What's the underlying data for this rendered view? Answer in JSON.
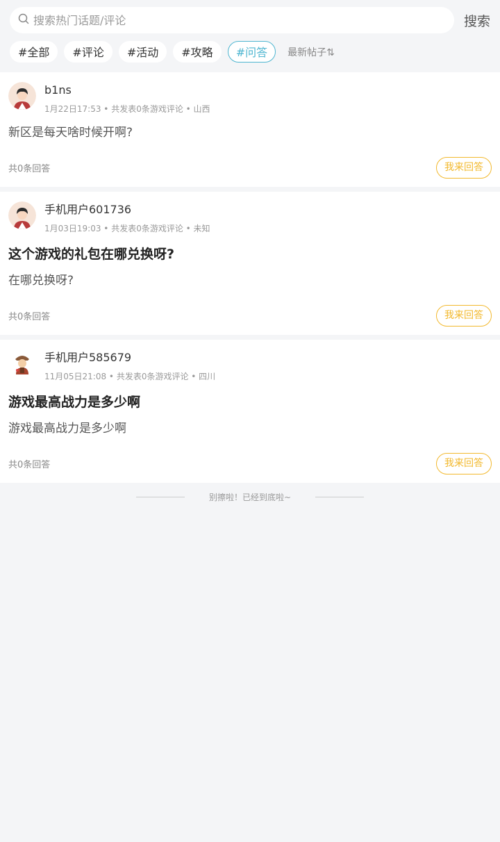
{
  "search": {
    "placeholder": "搜索热门话题/评论",
    "button": "搜索"
  },
  "tags": [
    "#全部",
    "#评论",
    "#活动",
    "#攻略",
    "#问答"
  ],
  "active_tag": 4,
  "sort_label": "最新帖子⇅",
  "posts": [
    {
      "user": "b1ns",
      "meta": "1月22日17:53 • 共发表0条游戏评论 • 山西",
      "title": "",
      "body": "新区是每天啥时候开啊?",
      "answer_count": "共0条回答",
      "answer_btn": "我来回答"
    },
    {
      "user": "手机用户601736",
      "meta": "1月03日19:03 • 共发表0条游戏评论 • 未知",
      "title": "这个游戏的礼包在哪兑换呀?",
      "body": "在哪兑换呀?",
      "answer_count": "共0条回答",
      "answer_btn": "我来回答"
    },
    {
      "user": "手机用户585679",
      "meta": "11月05日21:08 • 共发表0条游戏评论 • 四川",
      "title": "游戏最高战力是多少啊",
      "body": "游戏最高战力是多少啊",
      "answer_count": "共0条回答",
      "answer_btn": "我来回答"
    }
  ],
  "end_text": "别擦啦！已经到底啦~",
  "colors": {
    "accent_tag": "#4db5d0",
    "answer_button": "#f2b82c",
    "background": "#f4f5f7"
  }
}
